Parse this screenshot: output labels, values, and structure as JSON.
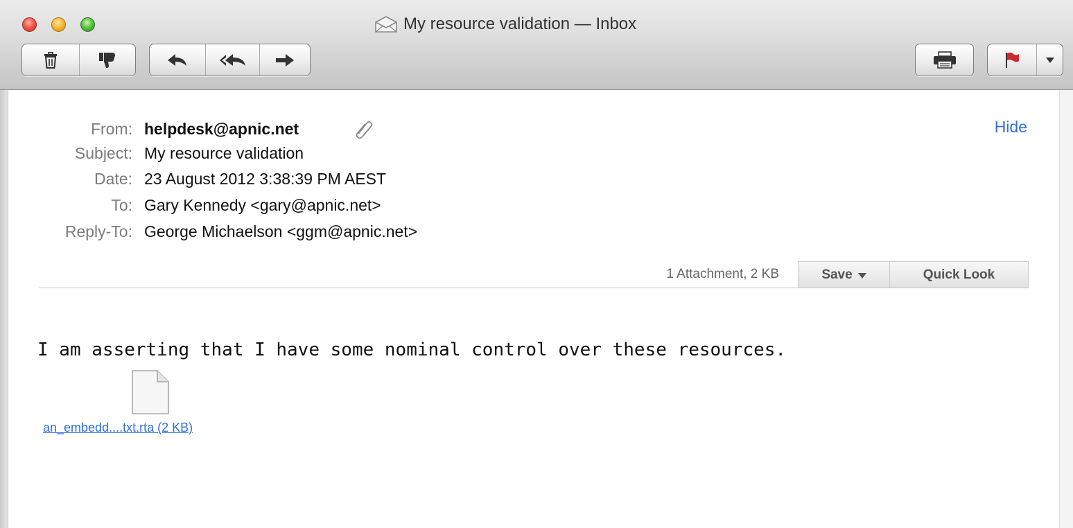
{
  "window": {
    "title": "My resource validation — Inbox"
  },
  "toolbar": {
    "groups": [
      {
        "name": "delete-junk",
        "icons": [
          "trash-icon",
          "thumbs-down-icon"
        ]
      },
      {
        "name": "reply-forward",
        "icons": [
          "reply-icon",
          "reply-all-icon",
          "forward-icon"
        ]
      },
      {
        "name": "print",
        "icons": [
          "printer-icon"
        ]
      },
      {
        "name": "flag",
        "icons": [
          "flag-icon",
          "chevron-down-icon"
        ]
      }
    ]
  },
  "header": {
    "from_label": "From:",
    "from_value": "helpdesk@apnic.net",
    "subject_label": "Subject:",
    "subject_value": "My resource validation",
    "date_label": "Date:",
    "date_value": "23 August 2012 3:38:39 PM AEST",
    "to_label": "To:",
    "to_value": "Gary Kennedy <gary@apnic.net>",
    "replyto_label": "Reply-To:",
    "replyto_value": "George Michaelson <ggm@apnic.net>",
    "hide_label": "Hide"
  },
  "attachments_bar": {
    "summary": "1 Attachment, 2 KB",
    "save_label": "Save",
    "quicklook_label": "Quick Look"
  },
  "body": {
    "text": "I am asserting that I have some nominal control over these resources.",
    "attachment_name": "an_embedd....txt.rta (2 KB)"
  },
  "colors": {
    "link": "#2f6fde",
    "label": "#7b7b7b",
    "close": "#f05a4b",
    "minimize": "#f8bb3a",
    "zoom": "#5dc24a",
    "flag": "#d0282e"
  }
}
